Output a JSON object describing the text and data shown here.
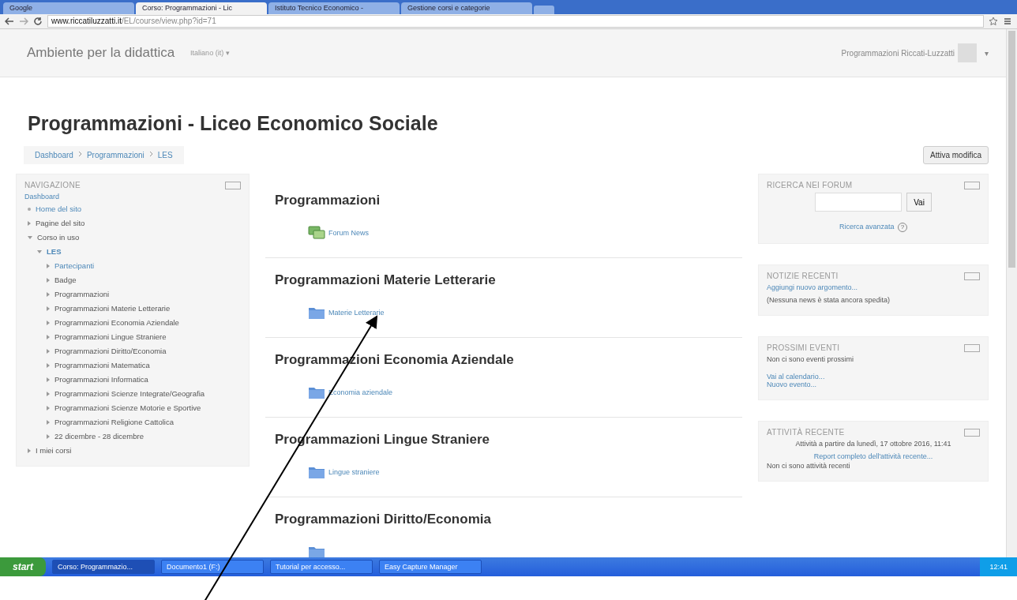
{
  "browser": {
    "tabs": [
      {
        "label": "Google",
        "selected": false
      },
      {
        "label": "Corso: Programmazioni - Lic",
        "selected": true
      },
      {
        "label": "Istituto Tecnico Economico -",
        "selected": false
      },
      {
        "label": "Gestione corsi e categorie",
        "selected": false
      }
    ],
    "url_host": "www.riccatiluzzatti.it",
    "url_path": "/EL/course/view.php?id=71"
  },
  "navbar": {
    "brand": "Ambiente per la didattica",
    "language": "Italiano (it) ▾",
    "user": "Programmazioni Riccati-Luzzatti",
    "menu": "▾"
  },
  "page": {
    "title": "Programmazioni - Liceo Economico Sociale",
    "breadcrumb": [
      "Dashboard",
      "Programmazioni",
      "LES"
    ],
    "edit_button": "Attiva modifica"
  },
  "navigation": {
    "title": "NAVIGAZIONE",
    "root": "Dashboard",
    "items": [
      {
        "label": "Home del sito",
        "kind": "leaf"
      },
      {
        "label": "Pagine del sito",
        "kind": "branch",
        "expanded": false
      },
      {
        "label": "Corso in uso",
        "kind": "branch",
        "expanded": true,
        "children": [
          {
            "label": "LES",
            "expanded": true,
            "children": [
              {
                "label": "Partecipanti",
                "kind": "link",
                "expanded": false
              },
              {
                "label": "Badge",
                "kind": "text",
                "expanded": false
              },
              {
                "label": "Programmazioni",
                "kind": "text",
                "expanded": false
              },
              {
                "label": "Programmazioni Materie Letterarie",
                "kind": "text",
                "expanded": false
              },
              {
                "label": "Programmazioni Economia Aziendale",
                "kind": "text",
                "expanded": false
              },
              {
                "label": "Programmazioni Lingue Straniere",
                "kind": "text",
                "expanded": false
              },
              {
                "label": "Programmazioni Diritto/Economia",
                "kind": "text",
                "expanded": false
              },
              {
                "label": "Programmazioni Matematica",
                "kind": "text",
                "expanded": false
              },
              {
                "label": "Programmazioni Informatica",
                "kind": "text",
                "expanded": false
              },
              {
                "label": "Programmazioni Scienze Integrate/Geografia",
                "kind": "text",
                "expanded": false
              },
              {
                "label": "Programmazioni Scienze Motorie e Sportive",
                "kind": "text",
                "expanded": false
              },
              {
                "label": "Programmazioni Religione Cattolica",
                "kind": "text",
                "expanded": false
              },
              {
                "label": "22 dicembre - 28 dicembre",
                "kind": "text",
                "expanded": false
              }
            ]
          }
        ]
      },
      {
        "label": "I miei corsi",
        "kind": "branch",
        "expanded": false
      }
    ]
  },
  "sections": [
    {
      "title": "Programmazioni",
      "activity": {
        "kind": "forum",
        "label": "Forum News"
      }
    },
    {
      "title": "Programmazioni Materie Letterarie",
      "activity": {
        "kind": "folder",
        "label": "Materie Letterarie"
      }
    },
    {
      "title": "Programmazioni Economia Aziendale",
      "activity": {
        "kind": "folder",
        "label": "Economia aziendale"
      }
    },
    {
      "title": "Programmazioni Lingue Straniere",
      "activity": {
        "kind": "folder",
        "label": "Lingue straniere"
      }
    },
    {
      "title": "Programmazioni Diritto/Economia",
      "activity": {
        "kind": "folder"
      }
    }
  ],
  "blocks": {
    "search": {
      "title": "RICERCA NEI FORUM",
      "button": "Vai",
      "advanced": "Ricerca avanzata",
      "help": "?"
    },
    "news": {
      "title": "NOTIZIE RECENTI",
      "link": "Aggiungi nuovo argomento...",
      "note": "(Nessuna news è stata ancora spedita)"
    },
    "events": {
      "title": "PROSSIMI EVENTI",
      "note": "Non ci sono eventi prossimi",
      "links": [
        "Vai al calendario...",
        "Nuovo evento..."
      ]
    },
    "activity": {
      "title": "ATTIVITÀ RECENTE",
      "since": "Attività a partire da lunedì, 17 ottobre 2016, 11:41",
      "link": "Report completo dell'attività recente...",
      "note": "Non ci sono attività recenti"
    }
  },
  "taskbar": {
    "start": "start",
    "items": [
      {
        "label": "Corso: Programmazio...",
        "selected": true
      },
      {
        "label": "Documento1 (F:)",
        "selected": false
      },
      {
        "label": "Tutorial per accesso...",
        "selected": false
      },
      {
        "label": "Easy Capture Manager",
        "selected": false
      }
    ],
    "clock": "12:41"
  }
}
